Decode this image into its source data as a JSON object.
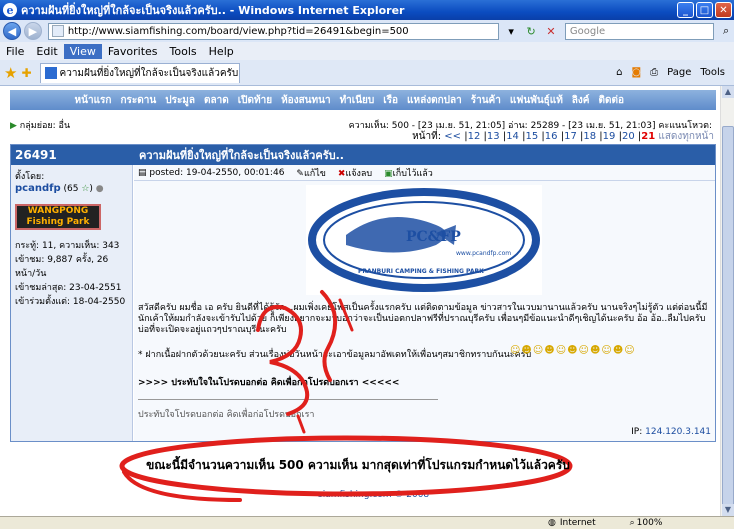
{
  "window": {
    "title": "ความฝันที่ยิ่งใหญ่ที่ใกล้จะเป็นจริงแล้วครับ.. - Windows Internet Explorer"
  },
  "address_bar": {
    "url": "http://www.siamfishing.com/board/view.php?tid=26491&begin=500",
    "search_placeholder": "Google"
  },
  "menu": [
    "File",
    "Edit",
    "View",
    "Favorites",
    "Tools",
    "Help"
  ],
  "tab": {
    "title": "ความฝันที่ยิ่งใหญ่ที่ใกล้จะเป็นจริงแล้วครับ.."
  },
  "toolbar": {
    "page_label": "Page",
    "tools_label": "Tools"
  },
  "site_nav": [
    "หน้าแรก",
    "กระดาน",
    "ประมูล",
    "ตลาด",
    "เปิดท้าย",
    "ห้องสนทนา",
    "ทำเนียบ",
    "เรือ",
    "แหล่งตกปลา",
    "ร้านค้า",
    "แฟนพันธุ์แท้",
    "ลิงค์",
    "ติดต่อ"
  ],
  "subgroup": "กลุ่มย่อย: อื่น",
  "thread_stats": "ความเห็น: 500 - [23 เม.ย. 51, 21:05] อ่าน: 25289 - [23 เม.ย. 51, 21:03] คะแนนโหวต:",
  "pager": {
    "label": "หน้าที่:",
    "prev": "<<",
    "pages": [
      "12",
      "13",
      "14",
      "15",
      "16",
      "17",
      "18",
      "19",
      "20"
    ],
    "current": "21",
    "all_label": "แสดงทุกหน้า"
  },
  "post": {
    "id": "26491",
    "title": "ความฝันที่ยิ่งใหญ่ที่ใกล้จะเป็นจริงแล้วครับ..",
    "posted_by_label": "ตั้งโดย:",
    "author": "pcandfp",
    "author_score": "(65",
    "author_logo_line1": "WANGPONG",
    "author_logo_line2": "Fishing Park",
    "author_stats": [
      "กระทู้: 11, ความเห็น: 343",
      "เข้าชม: 9,887 ครั้ง, 26 หน้า/วัน",
      "เข้าชมล่าสุด: 23-04-2551",
      "เข้าร่วมตั้งแต่: 18-04-2550"
    ],
    "posted": "posted: 19-04-2550, 00:01:46",
    "edit_label": "แก้ไข",
    "report_label": "แจ้งลบ",
    "save_label": "เก็บไว้แล้ว",
    "banner_logo": "PC&FP",
    "banner_url": "www.pcandfp.com",
    "banner_text": "PRANBURI CAMPING & FISHING PARK",
    "body_p1": "สวัสดีครับ ผมชื่อ เอ ครับ ยินดีที่ได้รู้จัก...ผมเพิ่งเคยโพสเป็นครั้งแรกครับ แต่ติดตามข้อมูล ข่าวสารในเวบมานานแล้วครับ นานจริงๆไม่รู้ตัว แต่ต่อนนี้มีนักเค้าให้ผมกำลังจะเข้ารับไปด้วย ก็เพียงอยากจะมาบอกว่าจะเป็นบ่อตกปลาฟรีที่ปราณบุรีครับ เพื่อนๆมีข้อแนะนำดีๆเชิญได้นะครับ อ้อ อ้อ..ลืมไปครับ บ่อที่จะเปิดจะอยู่แถวๆปราณบุรี นะครับ",
    "body_p2": "* ฝากเนื้อฝากตัวด้วยนะครับ ส่วนเรื่องบ่อวันหน้าจะเอาข้อมูลมาอัพเดทให้เพื่อนๆสมาชิกทราบกันนะครับ",
    "body_p3": ">>>> ประทับใจในโปรดบอกต่อ คิดเพื่อก่อโปรดบอกเรา <<<<<",
    "signature": "ประทับใจโปรดบอกต่อ คิดเพื่อก่อโปรดบอกเรา",
    "ip_label": "IP:",
    "ip": "124.120.3.141"
  },
  "annotation_text": "ขณะนี้มีจำนวนความเห็น 500 ความเห็น มากสุดเท่าที่โปรแกรมกำหนดไว้แล้วครับ",
  "footer": "siamfishing.com © 2008",
  "statusbar": {
    "zone": "Internet",
    "zoom": "100%"
  },
  "colors": {
    "nav_bar": "#6d97d3",
    "post_header": "#2a5ea8",
    "annotation_red": "#e0201c",
    "current_page": "#e00000"
  }
}
